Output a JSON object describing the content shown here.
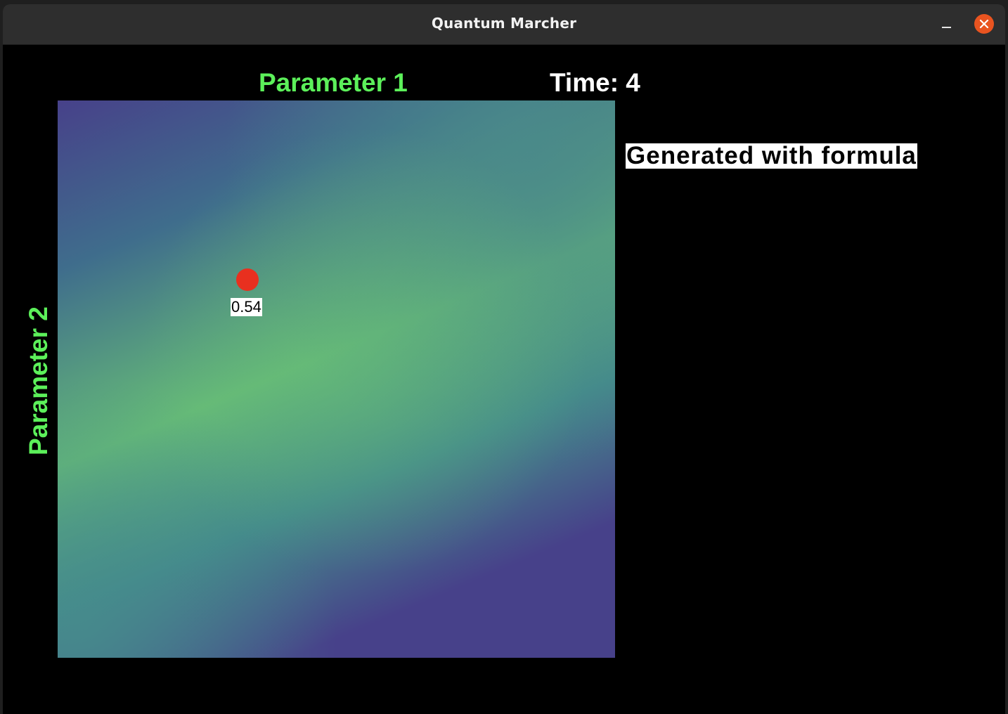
{
  "window": {
    "title": "Quantum Marcher"
  },
  "plot": {
    "x_label": "Parameter 1",
    "y_label": "Parameter 2",
    "time_text": "Time: 4",
    "marker_value": "0.54",
    "formula_note": "Generated with formula",
    "colors": {
      "axis_label": "#5cf05a",
      "marker": "#e8301f",
      "gradient_low": "#47418a",
      "gradient_mid": "#448b8b",
      "gradient_high": "#66bb77"
    }
  },
  "icons": {
    "minimize": "minimize-icon",
    "close": "close-icon"
  }
}
